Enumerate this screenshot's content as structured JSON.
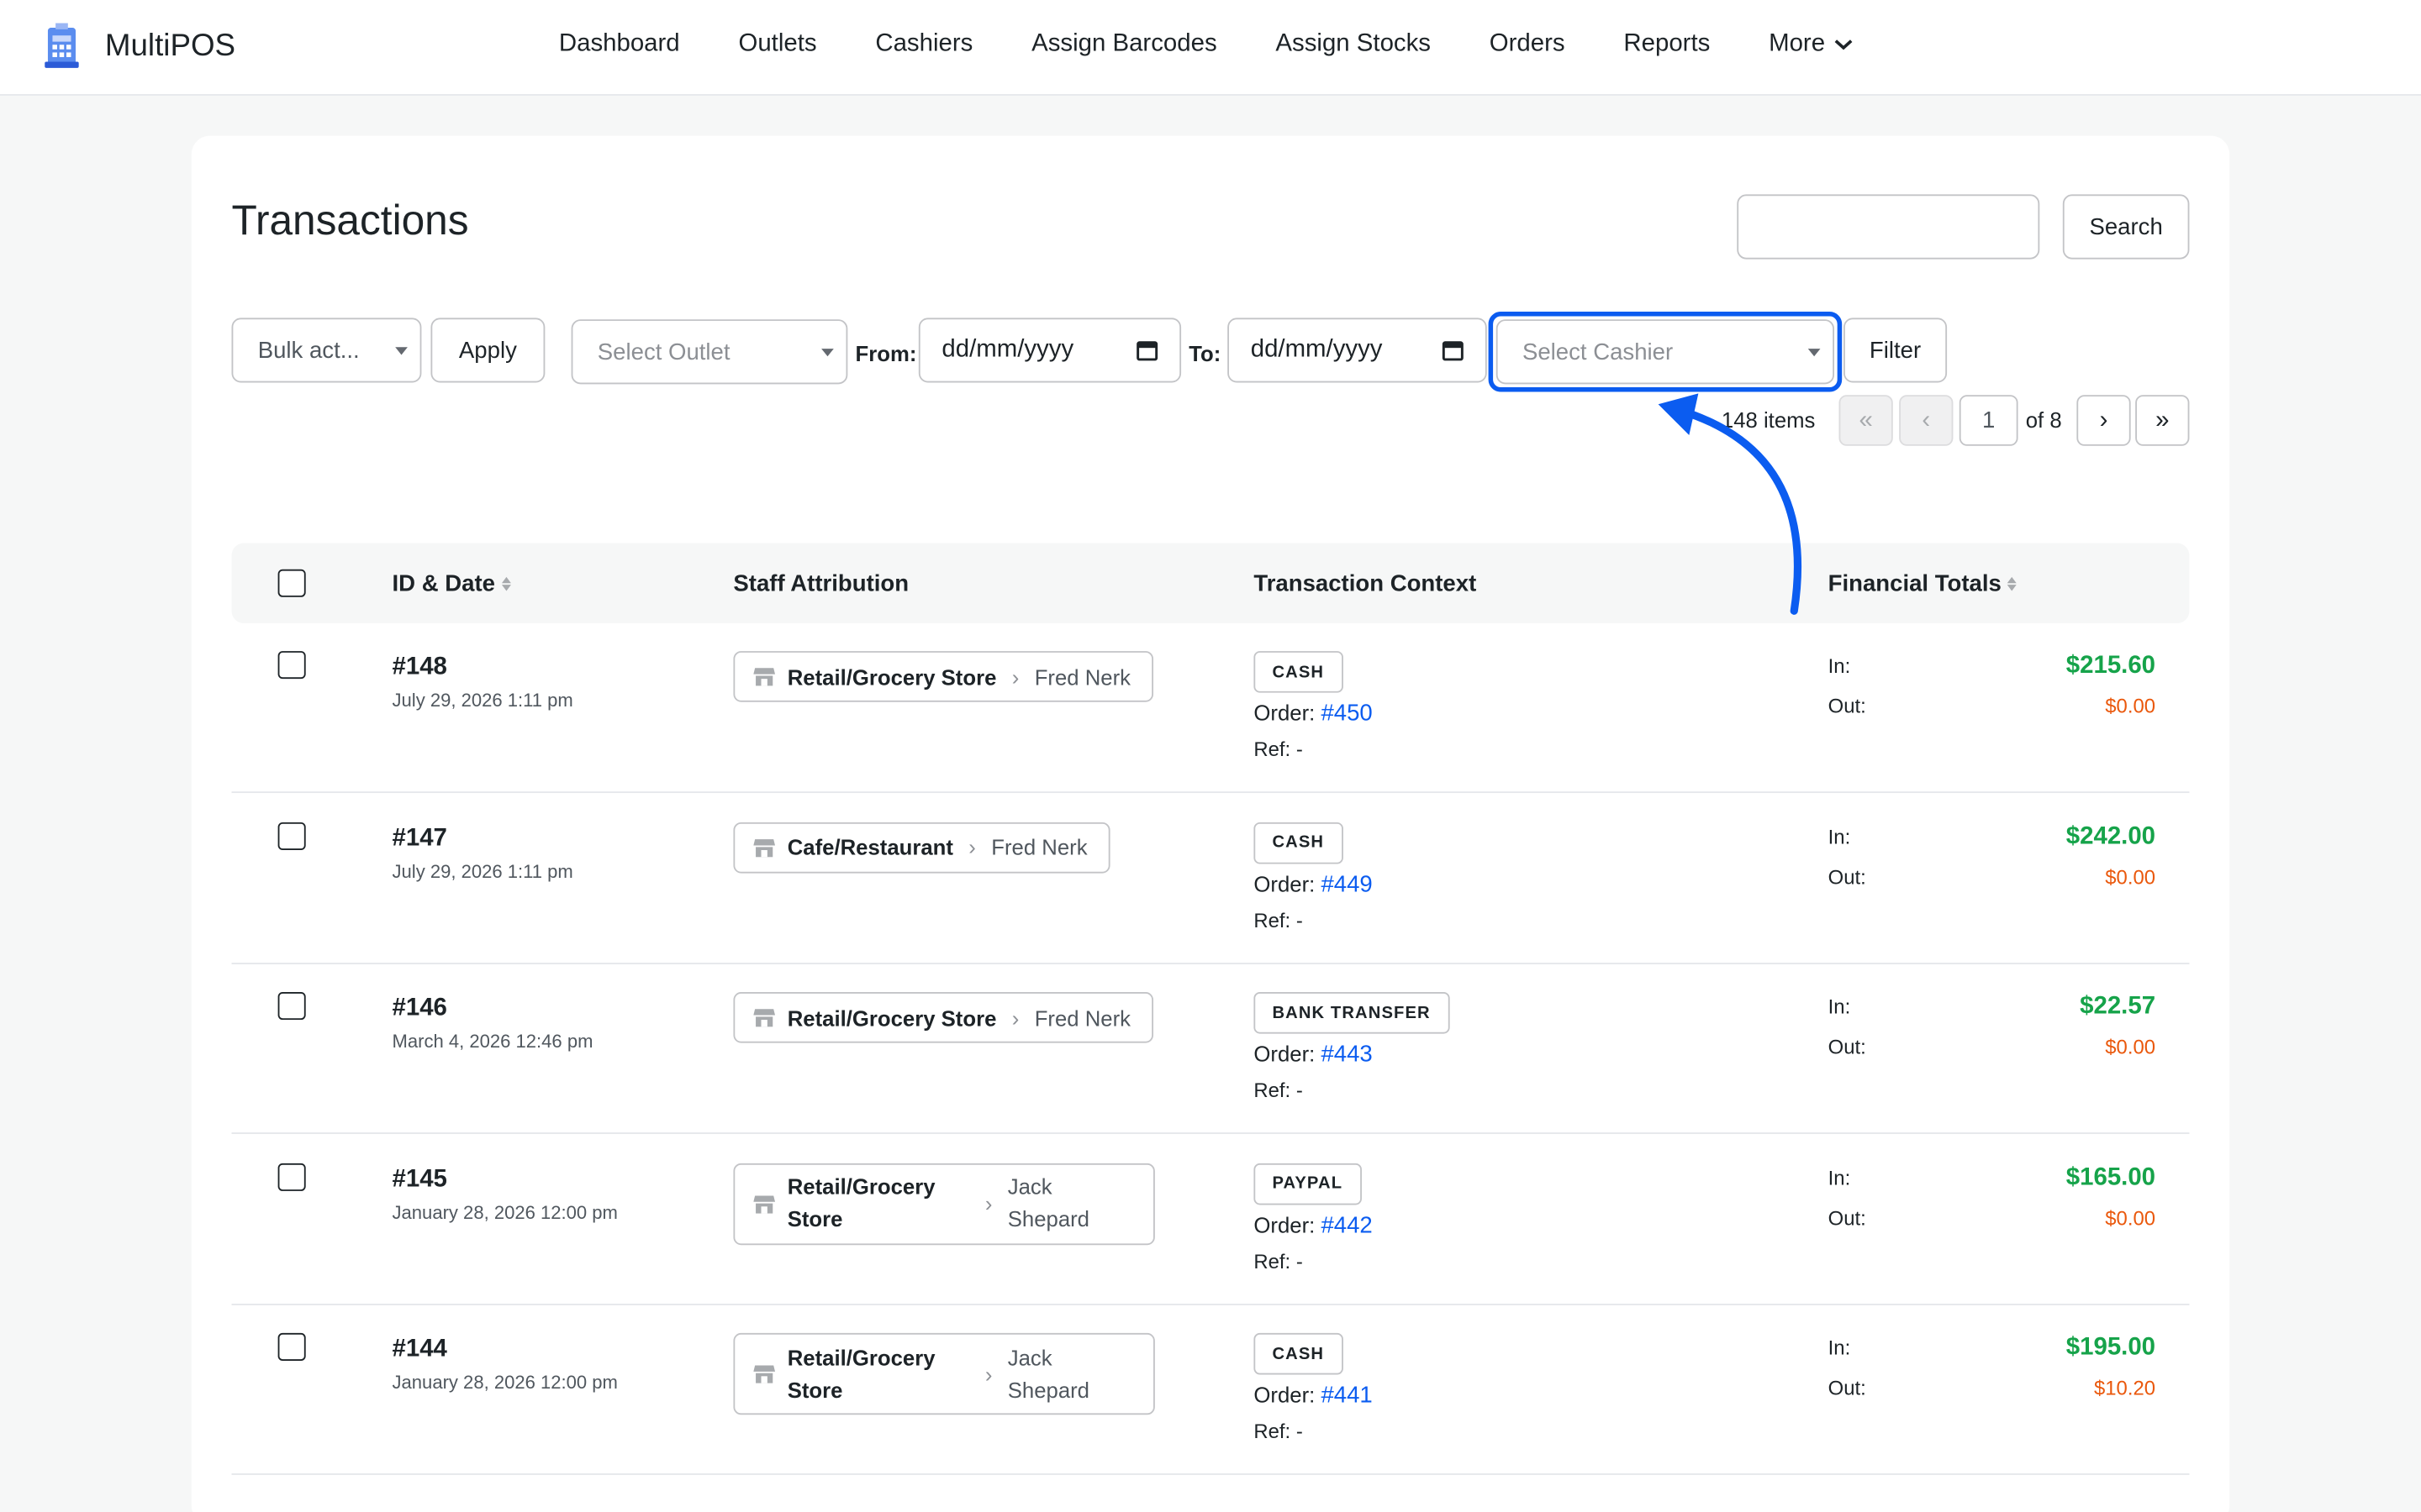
{
  "app": {
    "name": "MultiPOS"
  },
  "nav": {
    "items": [
      "Dashboard",
      "Outlets",
      "Cashiers",
      "Assign Barcodes",
      "Assign Stocks",
      "Orders",
      "Reports"
    ],
    "more_label": "More"
  },
  "page": {
    "title": "Transactions"
  },
  "search": {
    "value": "",
    "button_label": "Search"
  },
  "filters": {
    "bulk_action_label": "Bulk act...",
    "apply_label": "Apply",
    "outlet_placeholder": "Select Outlet",
    "from_label": "From:",
    "from_value": "dd/mm/yyyy",
    "to_label": "To:",
    "to_value": "dd/mm/yyyy",
    "cashier_placeholder": "Select Cashier",
    "filter_label": "Filter"
  },
  "pagination": {
    "items_text": "148 items",
    "first": "«",
    "prev": "‹",
    "current_page": "1",
    "of_text": "of 8",
    "next": "›",
    "last": "»"
  },
  "table": {
    "columns": [
      "ID & Date",
      "Staff Attribution",
      "Transaction Context",
      "Financial Totals"
    ],
    "order_label": "Order:",
    "ref_label": "Ref:",
    "in_label": "In:",
    "out_label": "Out:",
    "rows": [
      {
        "id": "#148",
        "date": "July 29, 2026 1:11 pm",
        "outlet": "Retail/Grocery Store",
        "cashier": "Fred Nerk",
        "payment": "CASH",
        "order": "#450",
        "ref": "-",
        "in": "$215.60",
        "out": "$0.00"
      },
      {
        "id": "#147",
        "date": "July 29, 2026 1:11 pm",
        "outlet": "Cafe/Restaurant",
        "cashier": "Fred Nerk",
        "payment": "CASH",
        "order": "#449",
        "ref": "-",
        "in": "$242.00",
        "out": "$0.00"
      },
      {
        "id": "#146",
        "date": "March 4, 2026 12:46 pm",
        "outlet": "Retail/Grocery Store",
        "cashier": "Fred Nerk",
        "payment": "BANK TRANSFER",
        "order": "#443",
        "ref": "-",
        "in": "$22.57",
        "out": "$0.00"
      },
      {
        "id": "#145",
        "date": "January 28, 2026 12:00 pm",
        "outlet": "Retail/Grocery Store",
        "cashier": "Jack Shepard",
        "payment": "PAYPAL",
        "order": "#442",
        "ref": "-",
        "in": "$165.00",
        "out": "$0.00"
      },
      {
        "id": "#144",
        "date": "January 28, 2026 12:00 pm",
        "outlet": "Retail/Grocery Store",
        "cashier": "Jack Shepard",
        "payment": "CASH",
        "order": "#441",
        "ref": "-",
        "in": "$195.00",
        "out": "$10.20"
      }
    ]
  },
  "colors": {
    "accent": "#0b5cf0",
    "in_amount": "#16a34a",
    "out_amount": "#ea580c"
  },
  "icons": {
    "logo": "pos-terminal-icon",
    "store": "store-icon",
    "calendar": "calendar-icon",
    "more": "chevron-down-icon"
  }
}
